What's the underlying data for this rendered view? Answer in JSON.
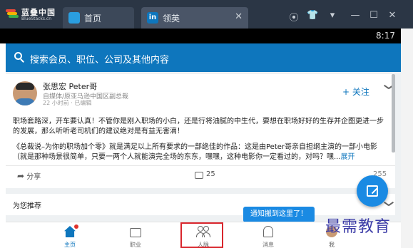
{
  "emulator": {
    "brand_name": "蓝叠中国",
    "brand_sub": "BlueStacks.cn",
    "tabs": [
      {
        "label": "首页",
        "close": ""
      },
      {
        "label": "领英",
        "close": "✕"
      }
    ],
    "controls": [
      "⦿",
      "👕",
      "▾",
      "—",
      "☐",
      "✕"
    ]
  },
  "status_bar": {
    "time": "8:17"
  },
  "search": {
    "placeholder": "搜索会员、职位、公司及其他内容"
  },
  "post": {
    "author": "张思宏 Peter哥",
    "headline": "自媒体/原亚马逊中国区副总裁",
    "meta": "22 小时前 · 已编辑",
    "follow_label": "+ 关注",
    "paragraph1": "职场套路深，开车要认真！不管你是刚入职场的小白，还是行将油腻的中生代，要想在职场好好的生存并企图更进一步的发展，那么听听老司机们的建议绝对是有益无害滴！",
    "paragraph2": "《总裁说–为你的职场加个零》就是满足以上所有要求的一部绝佳的作品：这是由Peter哥亲自担纲主演的一部小电影（就是那种场景很简单，只要一两个人就能演完全场的东东，嘿嘿，这种电影你一定看过的，对吗？嘿...",
    "more_label": "展开",
    "share_label": "分享",
    "comment_count": "25",
    "like_count": "255"
  },
  "recommend": {
    "title": "为您推荐"
  },
  "tooltip": {
    "text": "通知搬到这里了！"
  },
  "bottom_nav": [
    {
      "label": "主页"
    },
    {
      "label": "职业"
    },
    {
      "label": "人脉"
    },
    {
      "label": "消息"
    },
    {
      "label": "我"
    }
  ],
  "watermark": "最需教育",
  "colors": {
    "accent": "#0e76bd",
    "emulator_bar": "#2b3645",
    "highlight": "#d9262d"
  }
}
